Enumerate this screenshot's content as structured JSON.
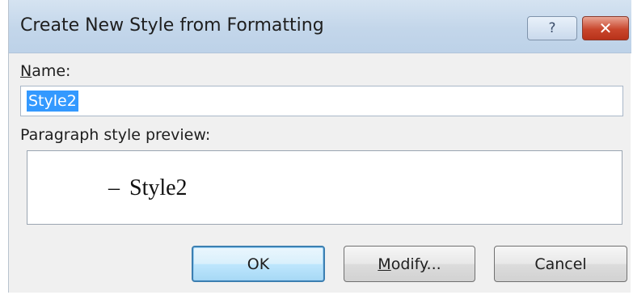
{
  "dialog": {
    "title": "Create New Style from Formatting",
    "help_glyph": "?",
    "close_glyph": "✕"
  },
  "name_field": {
    "label_accel": "N",
    "label_rest": "ame:",
    "value": "Style2"
  },
  "preview": {
    "label": "Paragraph style preview:",
    "dash": "–",
    "text": "Style2"
  },
  "buttons": {
    "ok": "OK",
    "modify_accel": "M",
    "modify_rest": "odify...",
    "cancel": "Cancel"
  },
  "colors": {
    "selection": "#3399ff",
    "titlebar": "#c3d6ea",
    "close_button": "#c9462c",
    "default_button_border": "#3c7fb1"
  },
  "icons": {
    "help": "help-icon",
    "close": "close-icon"
  }
}
